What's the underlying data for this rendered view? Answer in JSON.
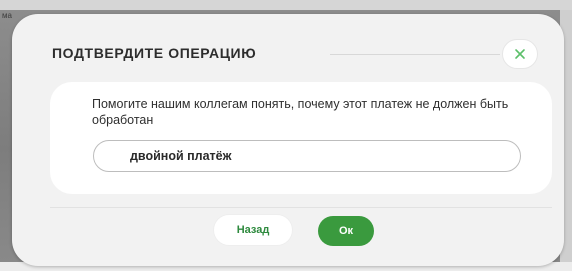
{
  "background": {
    "page_label": "ма"
  },
  "dialog": {
    "title": "ПОДТВЕРДИТЕ ОПЕРАЦИЮ",
    "close_icon": "close-icon",
    "prompt": "Помогите нашим коллегам понять, почему этот платеж не должен быть обработан",
    "reason_value": "двойной платёж",
    "back_label": "Назад",
    "ok_label": "Ок"
  },
  "colors": {
    "accent_green": "#3a9a3e",
    "close_icon_green": "#5cbf6a",
    "dialog_background": "#f2f2f2",
    "panel_background": "#ffffff"
  }
}
